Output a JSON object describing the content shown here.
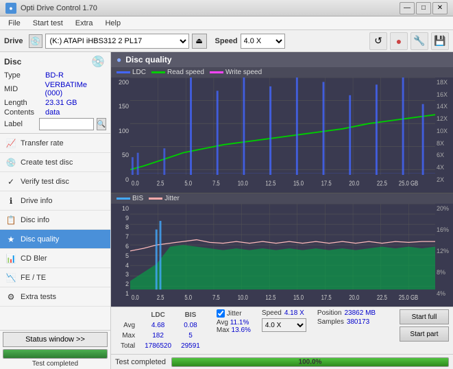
{
  "app": {
    "title": "Opti Drive Control 1.70",
    "icon": "●"
  },
  "title_controls": {
    "minimize": "—",
    "maximize": "□",
    "close": "✕"
  },
  "menu": {
    "items": [
      "File",
      "Start test",
      "Extra",
      "Help"
    ]
  },
  "toolbar": {
    "drive_label": "Drive",
    "drive_value": "(K:)  ATAPI iHBS312  2 PL17",
    "speed_label": "Speed",
    "speed_value": "4.0 X"
  },
  "disc": {
    "section_label": "Disc",
    "type_label": "Type",
    "type_value": "BD-R",
    "mid_label": "MID",
    "mid_value": "VERBATIMe (000)",
    "length_label": "Length",
    "length_value": "23.31 GB",
    "contents_label": "Contents",
    "contents_value": "data",
    "label_label": "Label",
    "label_placeholder": ""
  },
  "nav_items": [
    {
      "id": "transfer-rate",
      "label": "Transfer rate",
      "icon": "📈"
    },
    {
      "id": "create-test-disc",
      "label": "Create test disc",
      "icon": "💿"
    },
    {
      "id": "verify-test-disc",
      "label": "Verify test disc",
      "icon": "✓"
    },
    {
      "id": "drive-info",
      "label": "Drive info",
      "icon": "ℹ"
    },
    {
      "id": "disc-info",
      "label": "Disc info",
      "icon": "📋"
    },
    {
      "id": "disc-quality",
      "label": "Disc quality",
      "icon": "★",
      "active": true
    },
    {
      "id": "cd-bler",
      "label": "CD Bler",
      "icon": "📊"
    },
    {
      "id": "fe-te",
      "label": "FE / TE",
      "icon": "📉"
    },
    {
      "id": "extra-tests",
      "label": "Extra tests",
      "icon": "⚙"
    }
  ],
  "status": {
    "window_btn": "Status window >>",
    "progress_percent": 100,
    "status_text": "Test completed"
  },
  "chart": {
    "title": "Disc quality",
    "icon": "●",
    "legend": [
      {
        "label": "LDC",
        "color": "#4466ff"
      },
      {
        "label": "Read speed",
        "color": "#00cc00"
      },
      {
        "label": "Write speed",
        "color": "#ff44ff"
      }
    ],
    "legend2": [
      {
        "label": "BIS",
        "color": "#44aaff"
      },
      {
        "label": "Jitter",
        "color": "#ffcccc"
      }
    ],
    "top_y_labels": [
      "200",
      "150",
      "100",
      "50",
      "0"
    ],
    "top_y_right_labels": [
      "18X",
      "16X",
      "14X",
      "12X",
      "10X",
      "8X",
      "6X",
      "4X",
      "2X"
    ],
    "bot_y_labels": [
      "10",
      "9",
      "8",
      "7",
      "6",
      "5",
      "4",
      "3",
      "2",
      "1"
    ],
    "bot_y_right_labels": [
      "20%",
      "16%",
      "12%",
      "8%",
      "4%"
    ],
    "x_labels": [
      "0.0",
      "2.5",
      "5.0",
      "7.5",
      "10.0",
      "12.5",
      "15.0",
      "17.5",
      "20.0",
      "22.5",
      "25.0 GB"
    ]
  },
  "stats": {
    "col_headers": [
      "LDC",
      "BIS",
      "",
      "Jitter",
      "Speed"
    ],
    "rows": [
      {
        "label": "Avg",
        "ldc": "4.68",
        "bis": "0.08",
        "jitter": "11.1%",
        "speed": "4.18 X"
      },
      {
        "label": "Max",
        "ldc": "182",
        "bis": "5",
        "jitter": "13.6%",
        "speed_label": "Position",
        "speed_val": "23862 MB"
      },
      {
        "label": "Total",
        "ldc": "1786520",
        "bis": "29591",
        "jitter": "",
        "speed_label2": "Samples",
        "speed_val2": "380173"
      }
    ],
    "speed_select": "4.0 X",
    "jitter_checked": true
  },
  "buttons": {
    "start_full": "Start full",
    "start_part": "Start part"
  },
  "bottom": {
    "status": "Test completed",
    "progress": "100.0%",
    "progress_val": 100
  }
}
